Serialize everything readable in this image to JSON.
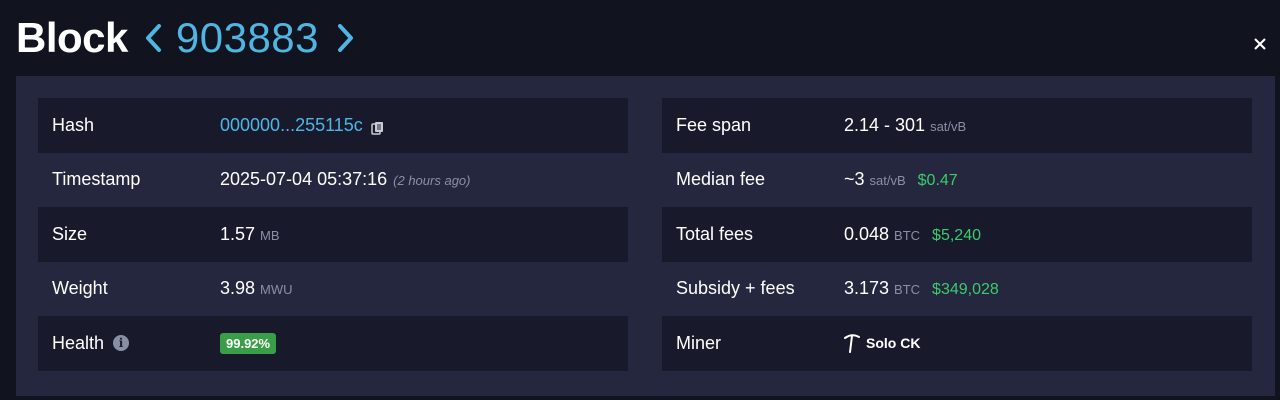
{
  "header": {
    "title": "Block",
    "block_number": "903883"
  },
  "icons": {
    "prev": "chevron-left-icon",
    "next": "chevron-right-icon",
    "close": "close-icon",
    "copy": "copy-icon",
    "info": "info-icon",
    "miner": "pickaxe-icon"
  },
  "colors": {
    "accent": "#4fb5e3",
    "usd": "#3bcb6b",
    "health_badge": "#3a9e48",
    "panel": "#24273e",
    "row_dark": "#181a2c"
  },
  "left": {
    "hash": {
      "label": "Hash",
      "value": "000000...255115c"
    },
    "timestamp": {
      "label": "Timestamp",
      "value": "2025-07-04 05:37:16",
      "relative": "(2 hours ago)"
    },
    "size": {
      "label": "Size",
      "value": "1.57",
      "unit": "MB"
    },
    "weight": {
      "label": "Weight",
      "value": "3.98",
      "unit": "MWU"
    },
    "health": {
      "label": "Health",
      "info": "i",
      "value": "99.92%"
    }
  },
  "right": {
    "fee_span": {
      "label": "Fee span",
      "value": "2.14 - 301",
      "unit": "sat/vB"
    },
    "median_fee": {
      "label": "Median fee",
      "value": "~3",
      "unit": "sat/vB",
      "usd": "$0.47"
    },
    "total_fees": {
      "label": "Total fees",
      "value": "0.048",
      "unit": "BTC",
      "usd": "$5,240"
    },
    "subsidy_fees": {
      "label": "Subsidy + fees",
      "value": "3.173",
      "unit": "BTC",
      "usd": "$349,028"
    },
    "miner": {
      "label": "Miner",
      "value": "Solo CK"
    }
  }
}
